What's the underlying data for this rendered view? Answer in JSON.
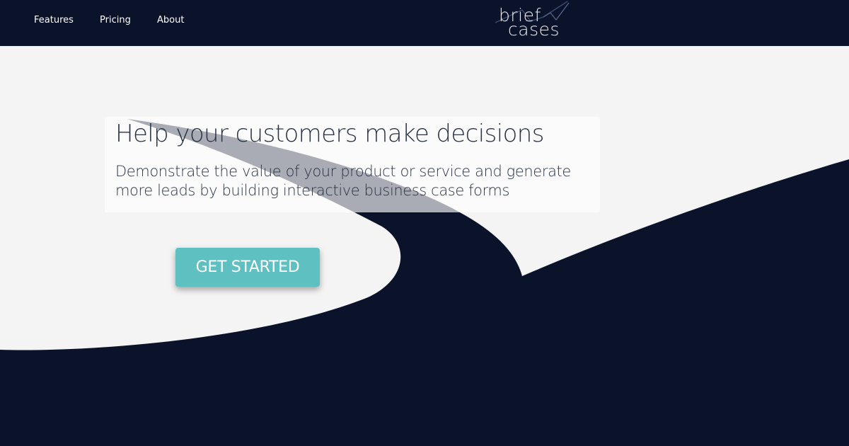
{
  "nav": {
    "links": [
      {
        "label": "Features"
      },
      {
        "label": "Pricing"
      },
      {
        "label": "About"
      }
    ]
  },
  "logo": {
    "line1": "brief",
    "line2": "cases"
  },
  "hero": {
    "title": "Help your customers make decisions",
    "subtitle": "Demonstrate the value of your product or service and generate more leads by building interactive business case forms",
    "cta_label": "GET STARTED"
  },
  "colors": {
    "navy": "#0b132a",
    "background": "#f4f4f4",
    "accent": "#5ec0c1",
    "text": "#2a3346"
  }
}
